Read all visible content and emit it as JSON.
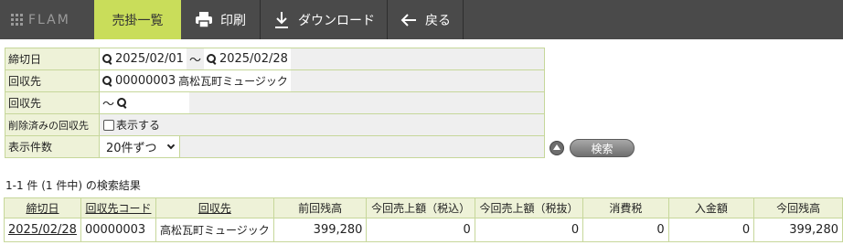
{
  "header": {
    "logo_text": "FLAM",
    "tabs": [
      {
        "label": "売掛一覧",
        "icon": ""
      },
      {
        "label": "印刷",
        "icon": "printer-icon"
      },
      {
        "label": "ダウンロード",
        "icon": "download-icon"
      },
      {
        "label": "戻る",
        "icon": "arrow-left-icon"
      }
    ],
    "colors": {
      "bar": "#4a4a4a",
      "active_tab": "#c9dd5a"
    }
  },
  "search": {
    "rows": [
      {
        "label": "締切日",
        "from": "2025/02/01",
        "sep": "～",
        "to": "2025/02/28"
      },
      {
        "label": "回収先",
        "code": "00000003",
        "name": "高松瓦町ミュージック"
      },
      {
        "label": "回収先",
        "sep": "～"
      },
      {
        "label": "削除済みの回収先",
        "checkbox_label": "表示する"
      },
      {
        "label": "表示件数",
        "selected": "20件ずつ"
      }
    ],
    "search_button": "検索"
  },
  "result_summary": "1-1 件 (1 件中) の検索結果",
  "table": {
    "headers": [
      "締切日",
      "回収先コード",
      "回収先",
      "前回残高",
      "今回売上額（税込）",
      "今回売上額（税抜）",
      "消費税",
      "入金額",
      "今回残高"
    ],
    "rows": [
      [
        "2025/02/28",
        "00000003",
        "高松瓦町ミュージック",
        "399,280",
        "0",
        "0",
        "0",
        "0",
        "399,280"
      ]
    ]
  }
}
